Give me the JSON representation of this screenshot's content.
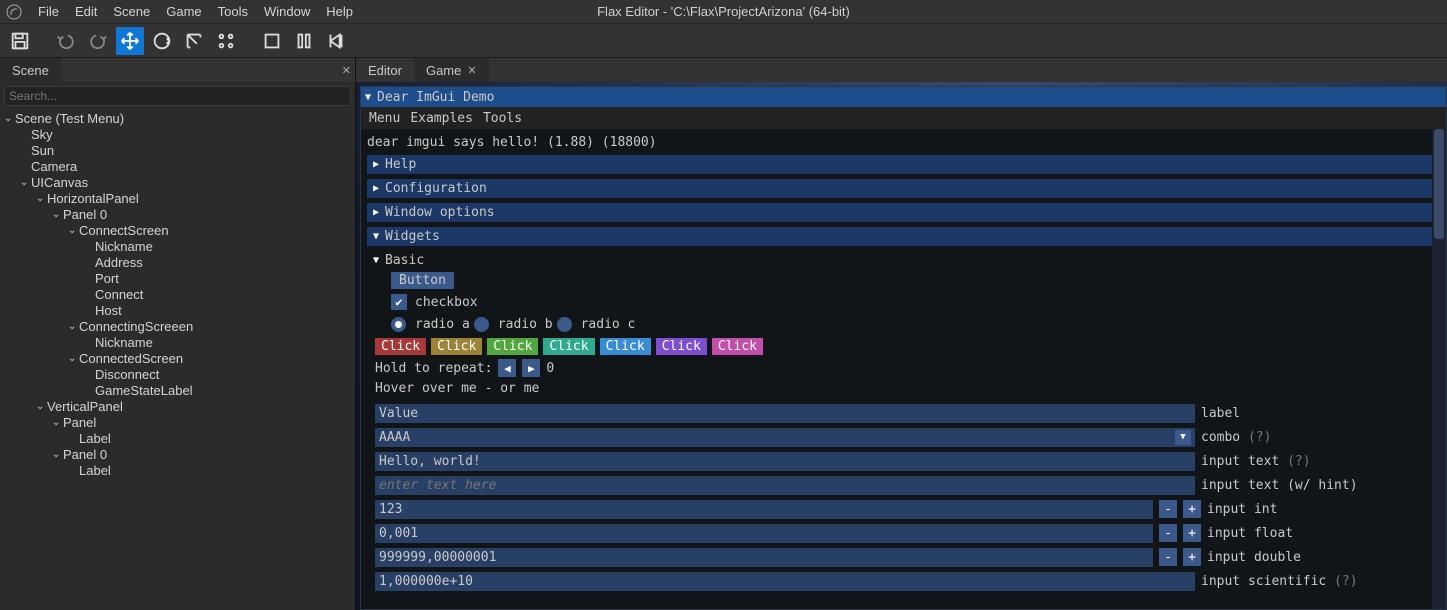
{
  "window_title": "Flax Editor - 'C:\\Flax\\ProjectArizona' (64-bit)",
  "main_menu": [
    "File",
    "Edit",
    "Scene",
    "Game",
    "Tools",
    "Window",
    "Help"
  ],
  "left_tabs": {
    "scene": "Scene"
  },
  "right_tabs": {
    "editor": "Editor",
    "game": "Game"
  },
  "search_placeholder": "Search...",
  "tree": [
    {
      "depth": 0,
      "arrow": "d",
      "label": "Scene (Test Menu)"
    },
    {
      "depth": 1,
      "arrow": "",
      "label": "Sky"
    },
    {
      "depth": 1,
      "arrow": "",
      "label": "Sun"
    },
    {
      "depth": 1,
      "arrow": "",
      "label": "Camera"
    },
    {
      "depth": 1,
      "arrow": "d",
      "label": "UICanvas"
    },
    {
      "depth": 2,
      "arrow": "d",
      "label": "HorizontalPanel"
    },
    {
      "depth": 3,
      "arrow": "d",
      "label": "Panel 0"
    },
    {
      "depth": 4,
      "arrow": "d",
      "label": "ConnectScreen"
    },
    {
      "depth": 5,
      "arrow": "",
      "label": "Nickname"
    },
    {
      "depth": 5,
      "arrow": "",
      "label": "Address"
    },
    {
      "depth": 5,
      "arrow": "",
      "label": "Port"
    },
    {
      "depth": 5,
      "arrow": "",
      "label": "Connect"
    },
    {
      "depth": 5,
      "arrow": "",
      "label": "Host"
    },
    {
      "depth": 4,
      "arrow": "d",
      "label": "ConnectingScreeen"
    },
    {
      "depth": 5,
      "arrow": "",
      "label": "Nickname"
    },
    {
      "depth": 4,
      "arrow": "d",
      "label": "ConnectedScreen"
    },
    {
      "depth": 5,
      "arrow": "",
      "label": "Disconnect"
    },
    {
      "depth": 5,
      "arrow": "",
      "label": "GameStateLabel"
    },
    {
      "depth": 2,
      "arrow": "d",
      "label": "VerticalPanel"
    },
    {
      "depth": 3,
      "arrow": "d",
      "label": "Panel"
    },
    {
      "depth": 4,
      "arrow": "",
      "label": "Label"
    },
    {
      "depth": 3,
      "arrow": "d",
      "label": "Panel 0"
    },
    {
      "depth": 4,
      "arrow": "",
      "label": "Label"
    }
  ],
  "imgui": {
    "title": "Dear ImGui Demo",
    "menubar": [
      "Menu",
      "Examples",
      "Tools"
    ],
    "hello": "dear imgui says hello! (1.88) (18800)",
    "headers": {
      "help": "Help",
      "config": "Configuration",
      "winopt": "Window options",
      "widgets": "Widgets"
    },
    "basic": "Basic",
    "button": "Button",
    "checkbox_label": "checkbox",
    "radios": [
      "radio a",
      "radio b",
      "radio c"
    ],
    "clicks": [
      {
        "label": "Click",
        "bg": "#a63a3a"
      },
      {
        "label": "Click",
        "bg": "#9c8336"
      },
      {
        "label": "Click",
        "bg": "#51a63d"
      },
      {
        "label": "Click",
        "bg": "#2faa8e"
      },
      {
        "label": "Click",
        "bg": "#398cd4"
      },
      {
        "label": "Click",
        "bg": "#7e4ed0"
      },
      {
        "label": "Click",
        "bg": "#c24ea9"
      }
    ],
    "repeat_label": "Hold to repeat:",
    "repeat_value": "0",
    "hover_text": "Hover over me - or me",
    "value_header": {
      "left": "Value",
      "right": "label"
    },
    "combo": {
      "value": "AAAA",
      "label": "combo",
      "hint": "(?)"
    },
    "input_text": {
      "value": "Hello, world!",
      "label": "input text",
      "hint": "(?)"
    },
    "input_text_hint": {
      "placeholder": "enter text here",
      "label": "input text (w/ hint)"
    },
    "input_int": {
      "value": "123",
      "label": "input int"
    },
    "input_float": {
      "value": "0,001",
      "label": "input float"
    },
    "input_double": {
      "value": "999999,00000001",
      "label": "input double"
    },
    "input_sci": {
      "value": "1,000000e+10",
      "label": "input scientific",
      "hint": "(?)"
    }
  }
}
